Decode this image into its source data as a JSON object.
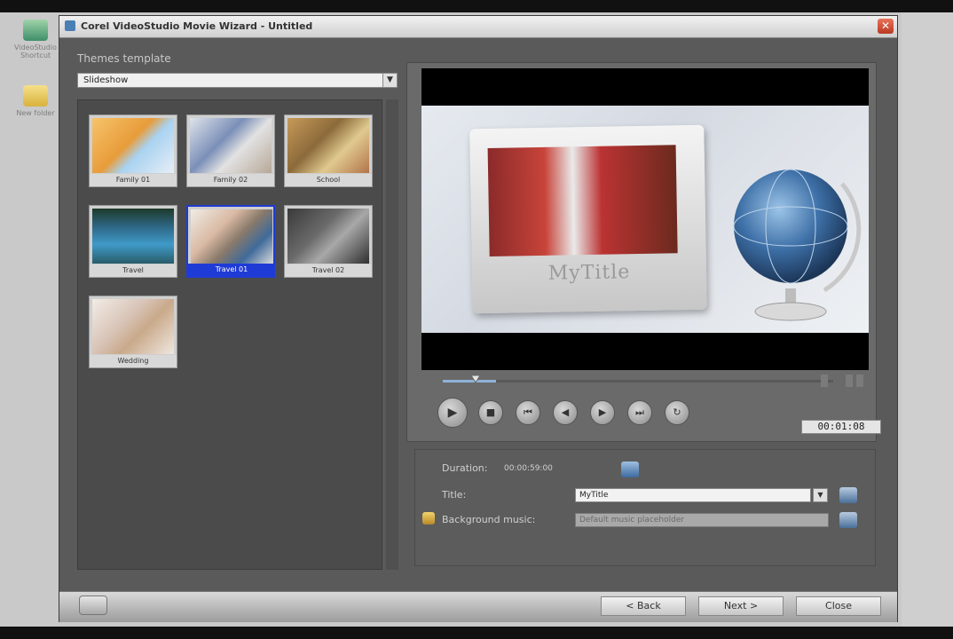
{
  "window": {
    "title": "Corel VideoStudio Movie Wizard - Untitled"
  },
  "desktop": {
    "icons": [
      {
        "label": "VideoStudio Shortcut",
        "icon": "app-shortcut-icon"
      },
      {
        "label": "New folder",
        "icon": "folder-icon"
      }
    ]
  },
  "templates": {
    "heading": "Themes template",
    "category": "Slideshow",
    "items": [
      {
        "label": "Family 01"
      },
      {
        "label": "Family 02"
      },
      {
        "label": "School"
      },
      {
        "label": "Travel"
      },
      {
        "label": "Travel 01"
      },
      {
        "label": "Travel 02"
      },
      {
        "label": "Wedding"
      }
    ],
    "selected_index": 4
  },
  "preview": {
    "caption": "MyTitle",
    "timecode": "00:01:08",
    "controls": [
      "play",
      "stop",
      "home",
      "previous",
      "next",
      "end",
      "repeat"
    ]
  },
  "settings": {
    "duration_label": "Duration:",
    "duration_value": "00:00:59:00",
    "title_label": "Title:",
    "title_value": "MyTitle",
    "music_label": "Background music:",
    "music_value": "Default music placeholder"
  },
  "footer": {
    "back_label": "< Back",
    "next_label": "Next >",
    "close_label": "Close"
  },
  "colors": {
    "selection": "#1f3bd6",
    "window_bg": "#5a5a5a",
    "close_button": "#c8462e"
  }
}
